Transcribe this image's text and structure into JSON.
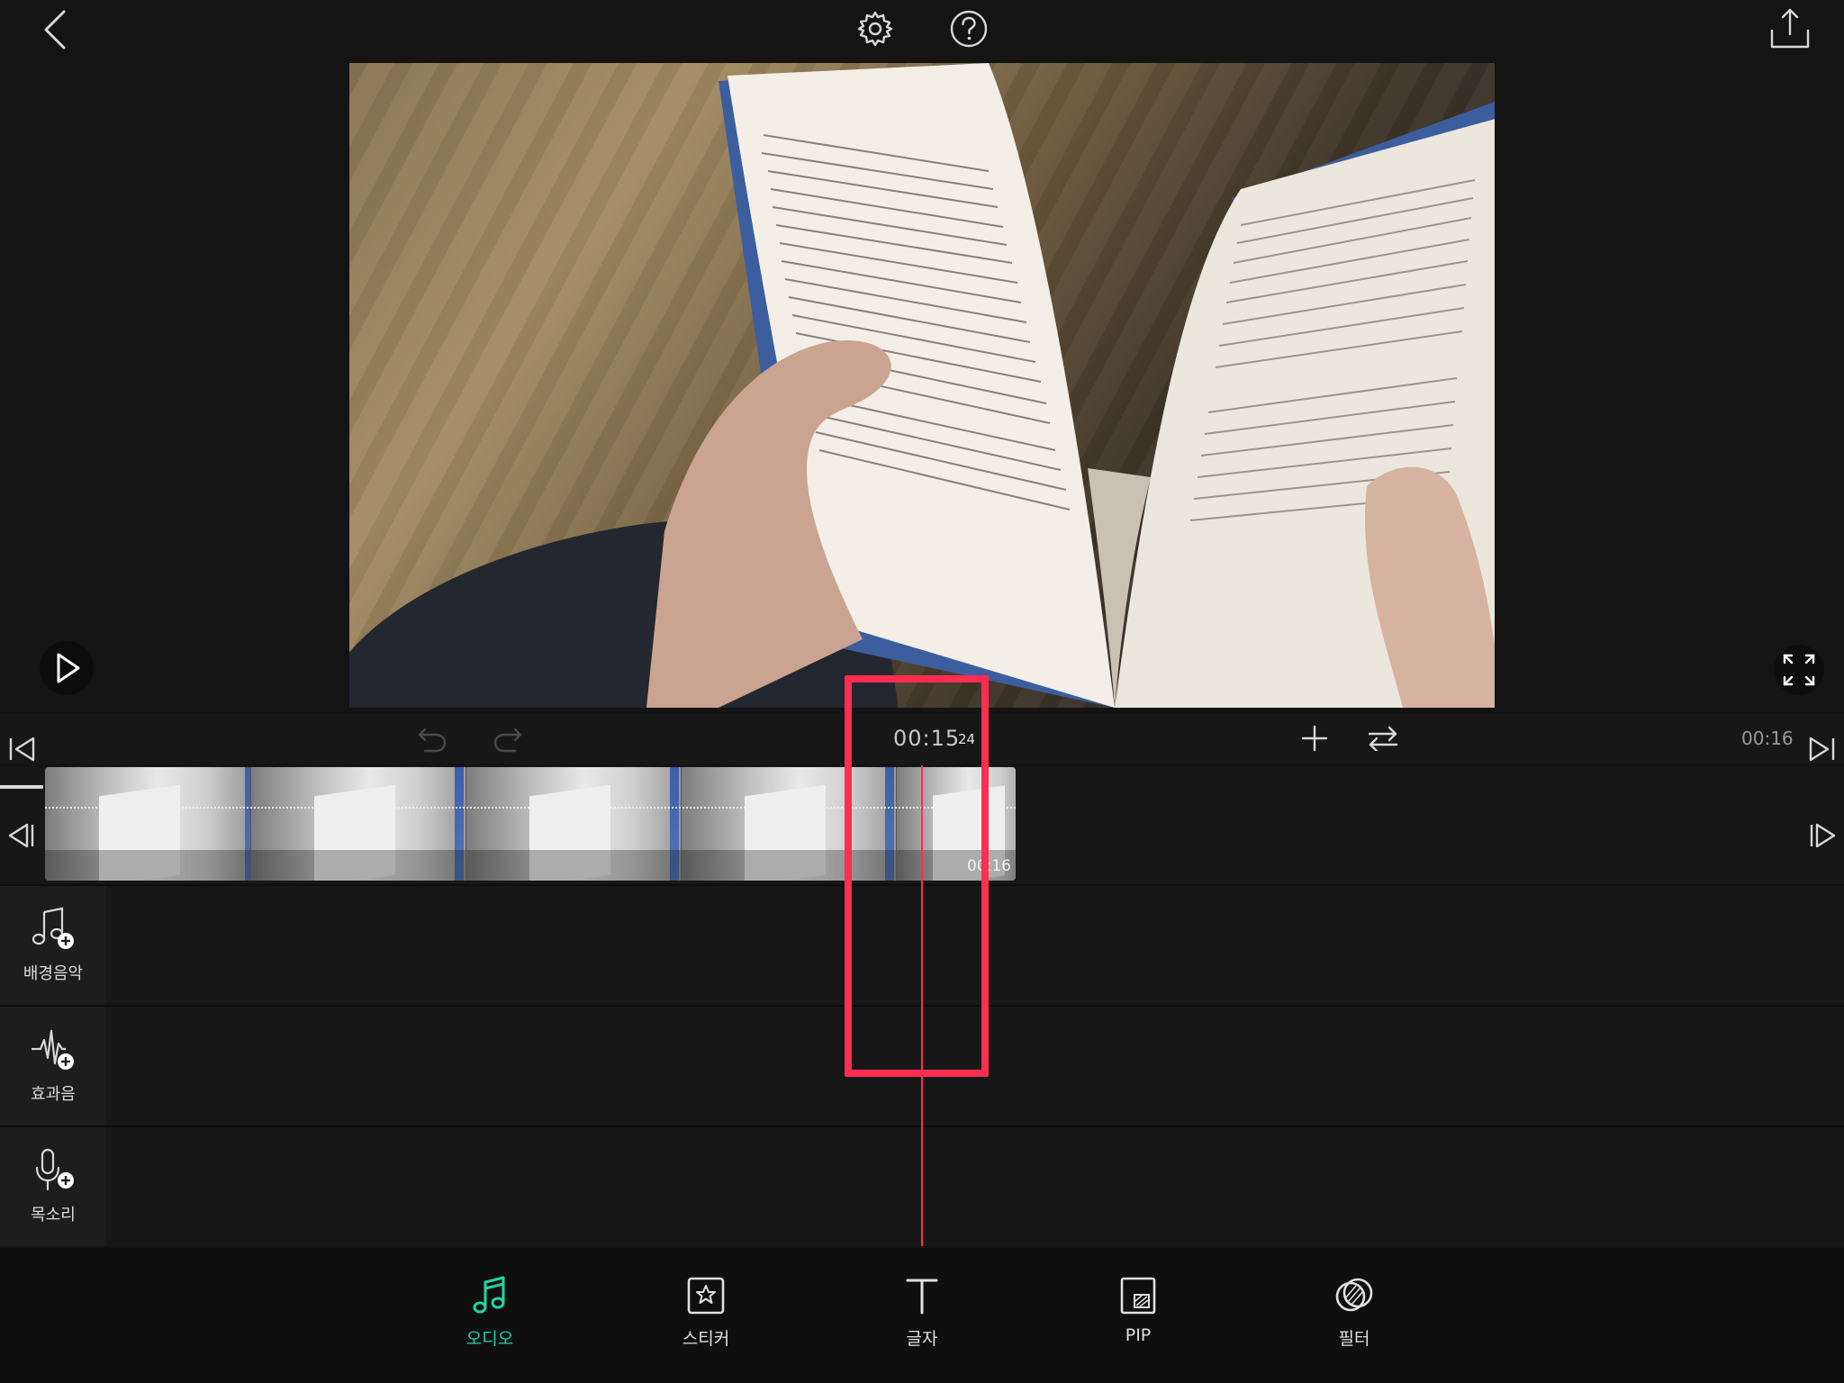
{
  "colors": {
    "accent": "#22d3a5",
    "playhead": "#ff2d55",
    "highlight_box": "#ff2d4f",
    "background": "#141414"
  },
  "toolbar": {
    "back_icon": "chevron-left-icon",
    "settings_icon": "gear-icon",
    "help_icon": "question-circle-icon",
    "export_icon": "share-icon"
  },
  "preview": {
    "play_icon": "play-icon",
    "fullscreen_icon": "expand-icon"
  },
  "timeline": {
    "current_time": "00:15",
    "current_frame": "24",
    "total_time": "00:16",
    "clip_duration": "00:16",
    "icons": [
      "skip-to-start-icon",
      "undo-icon",
      "redo-icon",
      "add-icon",
      "swap-icon",
      "skip-to-end-icon",
      "prev-frame-icon",
      "next-frame-icon"
    ]
  },
  "tracks": [
    {
      "label": "배경음악",
      "icon": "music-note-add-icon"
    },
    {
      "label": "효과음",
      "icon": "waveform-add-icon"
    },
    {
      "label": "목소리",
      "icon": "microphone-add-icon"
    }
  ],
  "bottom_nav": [
    {
      "label": "오디오",
      "icon": "music-icon",
      "active": true
    },
    {
      "label": "스티커",
      "icon": "sticker-icon",
      "active": false
    },
    {
      "label": "글자",
      "icon": "text-icon",
      "active": false
    },
    {
      "label": "PIP",
      "icon": "pip-icon",
      "active": false
    },
    {
      "label": "필터",
      "icon": "filter-icon",
      "active": false
    }
  ]
}
